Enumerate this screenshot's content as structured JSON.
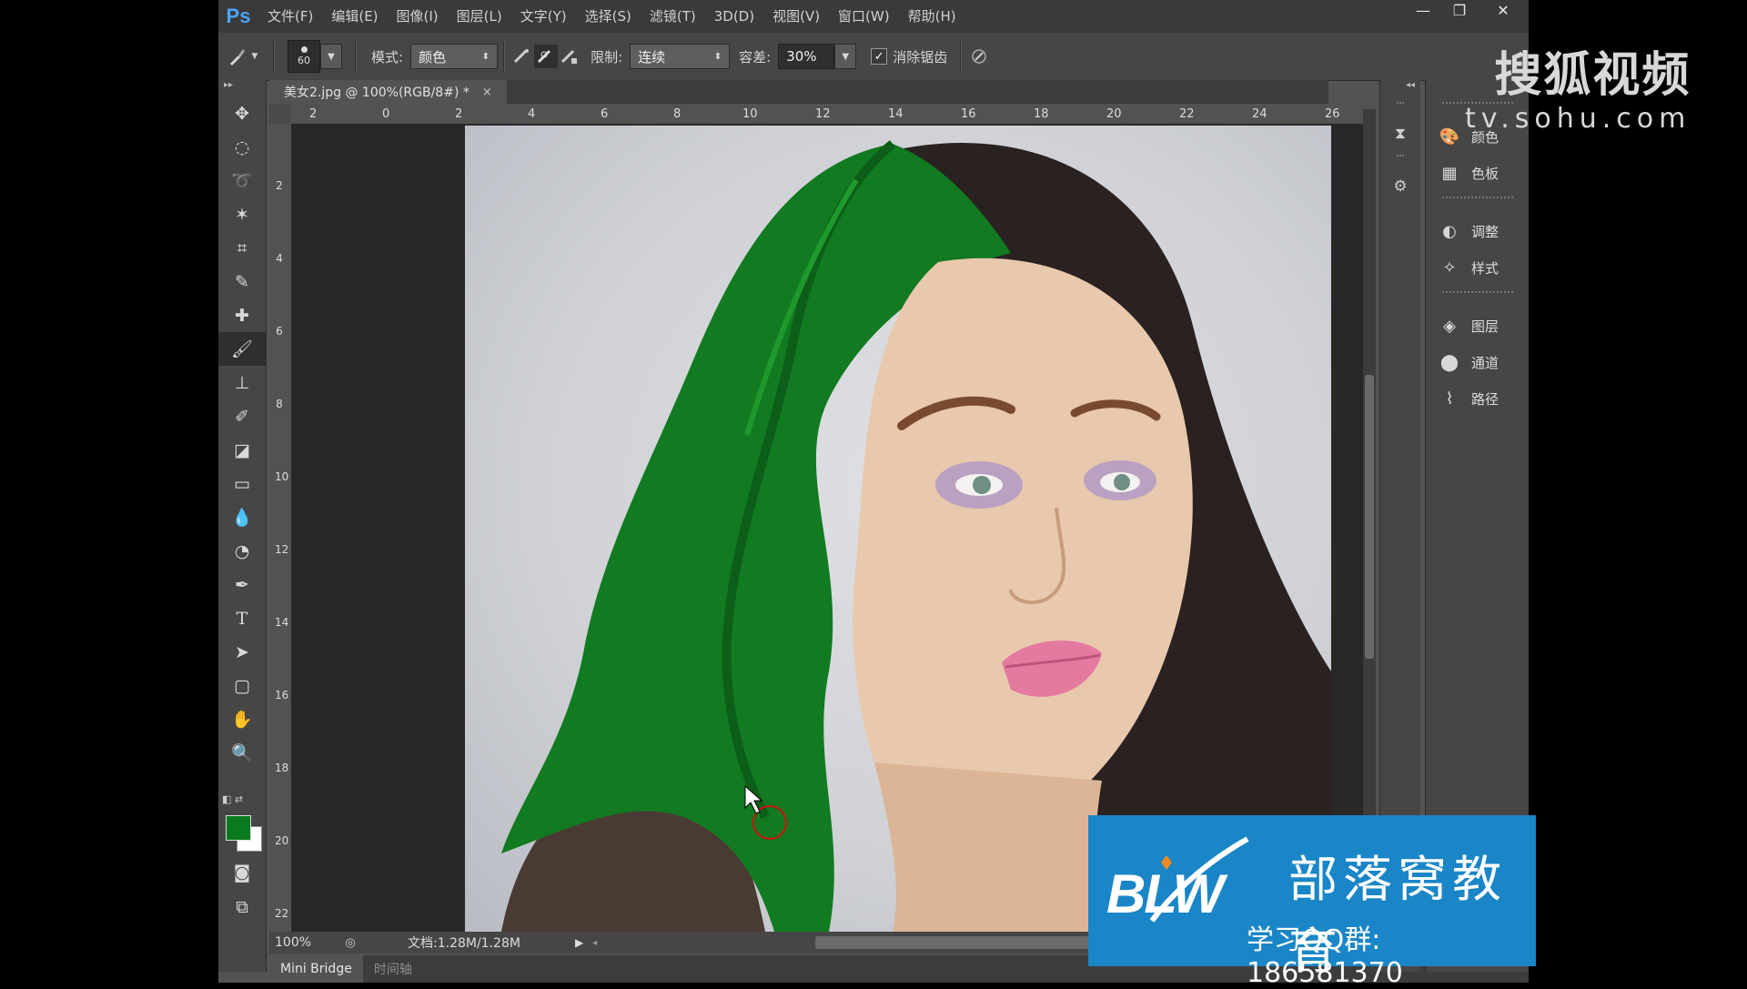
{
  "app": {
    "logo": "Ps",
    "menu": [
      "文件(F)",
      "编辑(E)",
      "图像(I)",
      "图层(L)",
      "文字(Y)",
      "选择(S)",
      "滤镜(T)",
      "3D(D)",
      "视图(V)",
      "窗口(W)",
      "帮助(H)"
    ],
    "window_buttons": [
      "—",
      "❐",
      "✕"
    ]
  },
  "options": {
    "brush_size": "60",
    "mode_label": "模式:",
    "mode_value": "颜色",
    "limit_label": "限制:",
    "limit_value": "连续",
    "tolerance_label": "容差:",
    "tolerance_value": "30%",
    "antialias_checked": "✓",
    "antialias_label": "消除锯齿"
  },
  "document": {
    "tab_title": "美女2.jpg @ 100%(RGB/8#) *",
    "tab_close": "×",
    "ruler_h": [
      "2",
      "0",
      "2",
      "4",
      "6",
      "8",
      "10",
      "12",
      "14",
      "16",
      "18",
      "20",
      "22",
      "24",
      "26"
    ],
    "ruler_v": [
      "2",
      "4",
      "6",
      "8",
      "10",
      "12",
      "14",
      "16",
      "18",
      "20",
      "22"
    ]
  },
  "status": {
    "zoom": "100%",
    "doc_info": "文档:1.28M/1.28M"
  },
  "bottom_tabs": [
    "Mini Bridge",
    "时间轴"
  ],
  "panels": [
    {
      "icon": "palette-icon",
      "glyph": "🎨",
      "label": "颜色"
    },
    {
      "icon": "swatches-icon",
      "glyph": "▦",
      "label": "色板"
    },
    {
      "icon": "adjustments-icon",
      "glyph": "◐",
      "label": "调整"
    },
    {
      "icon": "styles-icon",
      "glyph": "✧",
      "label": "样式"
    },
    {
      "icon": "layers-icon",
      "glyph": "◈",
      "label": "图层"
    },
    {
      "icon": "channels-icon",
      "glyph": "⬤",
      "label": "通道"
    },
    {
      "icon": "paths-icon",
      "glyph": "⌇",
      "label": "路径"
    }
  ],
  "colors": {
    "foreground": "#0a7a1e",
    "background": "#ffffff",
    "ps_blue": "#4aa3ff",
    "blw_blue": "#1a86c7"
  },
  "watermarks": {
    "sohu_main": "搜狐视频",
    "sohu_url": "tv.sohu.com",
    "blw_logo": "BLW",
    "blw_name": "部落窝教育",
    "blw_qq": "学习QQ群: 186581370"
  }
}
